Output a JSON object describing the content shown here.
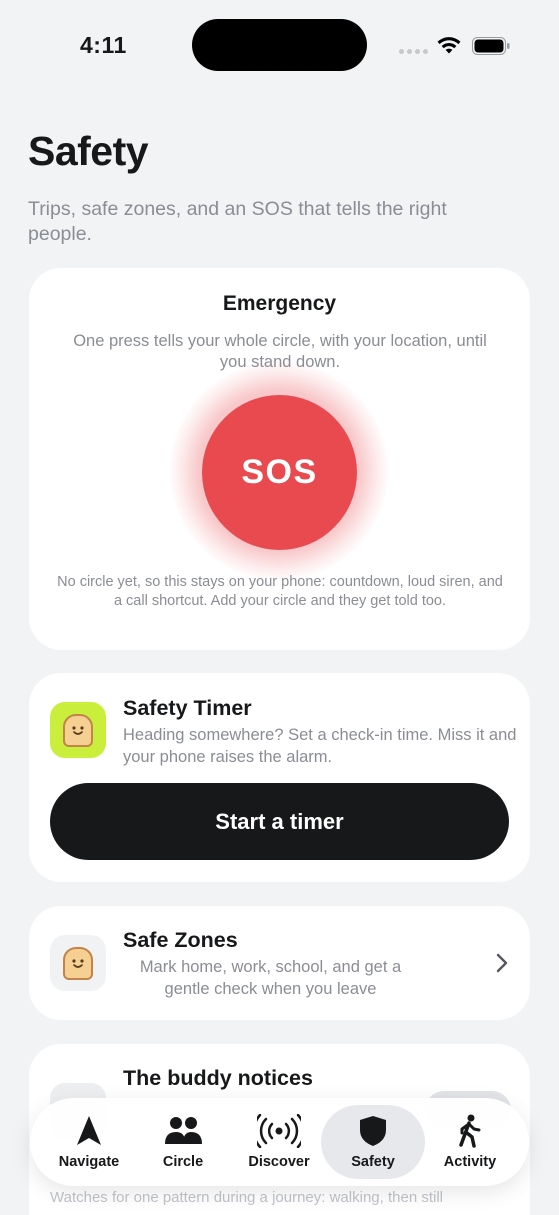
{
  "status_bar": {
    "time": "4:11"
  },
  "header": {
    "title": "Safety",
    "subtitle": "Trips, safe zones, and an SOS that tells the right people."
  },
  "emergency": {
    "title": "Emergency",
    "description": "One press tells your whole circle, with your location, until you stand down.",
    "sos_label": "SOS",
    "note": "No circle yet, so this stays on your phone: countdown, loud siren, and a call shortcut. Add your circle and they get told too."
  },
  "safety_timer": {
    "title": "Safety Timer",
    "description": "Heading somewhere? Set a check-in time. Miss it and your phone raises the alarm.",
    "button_label": "Start a timer"
  },
  "safe_zones": {
    "title": "Safe Zones",
    "description": "Mark home, work, school, and get a gentle check when you leave"
  },
  "buddy": {
    "title": "The buddy notices",
    "note": "Watches for one pattern during a journey: walking, then still"
  },
  "tabs": [
    {
      "label": "Navigate",
      "icon": "navigate-arrow-icon"
    },
    {
      "label": "Circle",
      "icon": "people-icon"
    },
    {
      "label": "Discover",
      "icon": "broadcast-icon"
    },
    {
      "label": "Safety",
      "icon": "shield-icon",
      "active": true
    },
    {
      "label": "Activity",
      "icon": "walking-person-icon"
    }
  ],
  "colors": {
    "sos_red": "#e84a50",
    "timer_icon_bg": "#c9ee3c",
    "primary_button": "#17181a",
    "background": "#f2f3f5"
  }
}
